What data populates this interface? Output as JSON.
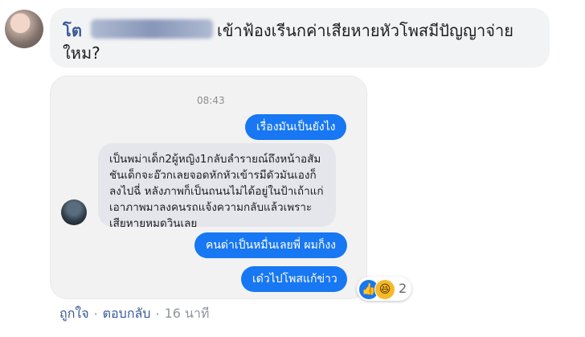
{
  "comment": {
    "author": "โต",
    "text_line1": "เข้าฟ้องเรีนกค่าเสียหายหัวโพสมีปัญญาจ่าย",
    "text_line2": "ใหม?"
  },
  "chat": {
    "time": "08:43",
    "messages": [
      {
        "type": "sent",
        "text": "เรื่องมันเป็นยังไง"
      },
      {
        "type": "received",
        "text": "เป็นพม่าเด็ก2ผู้หญิง1กลับลำรายณ์ถึงหน้าอสัมชันเด็กจะอ๊วกเลยจอดหักหัวเข้ารมีดัวมันเองก็ลงไปฉี่ หลังภาพก็เป็นถนนไม่ได้อยู่ในป้าเถ้าแก่เอาภาพมาลงคนรถแจ้งความกลับแล้วเพราะเสียหายหมดวินเลย"
      },
      {
        "type": "sent",
        "text": "คนด่าเป็นหมื่นเลยพี่ ผมก็งง"
      },
      {
        "type": "sent",
        "text": "เด๋วไปโพสแก้ข่าว"
      }
    ]
  },
  "reactions": {
    "icons": [
      "like-icon",
      "haha-icon"
    ],
    "count": "2"
  },
  "footer": {
    "like_label": "ถูกใจ",
    "reply_label": "ตอบกลับ",
    "separator": "·",
    "time": "16 นาที"
  }
}
